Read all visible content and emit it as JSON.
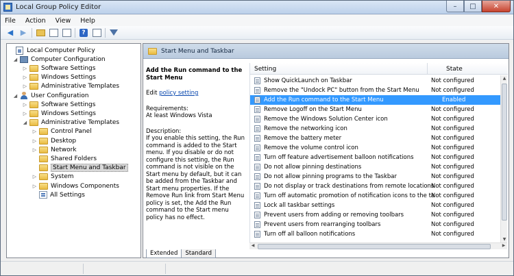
{
  "window": {
    "title": "Local Group Policy Editor",
    "controls": [
      "–",
      "□",
      "✕"
    ]
  },
  "menu": [
    "File",
    "Action",
    "View",
    "Help"
  ],
  "toolbar": {
    "back": "◀",
    "forward": "▶",
    "help": "?"
  },
  "tree": [
    {
      "label": "Local Computer Policy",
      "icon": "policy",
      "expander": "",
      "indent": 0
    },
    {
      "label": "Computer Configuration",
      "icon": "computer",
      "expander": "◢",
      "indent": 1
    },
    {
      "label": "Software Settings",
      "icon": "folder",
      "expander": "▷",
      "indent": 2
    },
    {
      "label": "Windows Settings",
      "icon": "folder",
      "expander": "▷",
      "indent": 2
    },
    {
      "label": "Administrative Templates",
      "icon": "folder",
      "expander": "▷",
      "indent": 2
    },
    {
      "label": "User Configuration",
      "icon": "user",
      "expander": "◢",
      "indent": 1
    },
    {
      "label": "Software Settings",
      "icon": "folder",
      "expander": "▷",
      "indent": 2
    },
    {
      "label": "Windows Settings",
      "icon": "folder",
      "expander": "▷",
      "indent": 2
    },
    {
      "label": "Administrative Templates",
      "icon": "folder",
      "expander": "◢",
      "indent": 2
    },
    {
      "label": "Control Panel",
      "icon": "folder",
      "expander": "▷",
      "indent": 3
    },
    {
      "label": "Desktop",
      "icon": "folder",
      "expander": "▷",
      "indent": 3
    },
    {
      "label": "Network",
      "icon": "folder",
      "expander": "▷",
      "indent": 3
    },
    {
      "label": "Shared Folders",
      "icon": "folder",
      "expander": "",
      "indent": 3
    },
    {
      "label": "Start Menu and Taskbar",
      "icon": "folder",
      "expander": "",
      "indent": 3,
      "selected": true
    },
    {
      "label": "System",
      "icon": "folder",
      "expander": "▷",
      "indent": 3
    },
    {
      "label": "Windows Components",
      "icon": "folder",
      "expander": "▷",
      "indent": 3
    },
    {
      "label": "All Settings",
      "icon": "allsettings",
      "expander": "",
      "indent": 3
    }
  ],
  "pane": {
    "header_title": "Start Menu and Taskbar",
    "desc_title": "Add the Run command to the Start Menu",
    "edit_prefix": "Edit ",
    "edit_link": "policy setting",
    "requirements_label": "Requirements:",
    "requirements_value": "At least Windows Vista",
    "description_label": "Description:",
    "description_text": "If you enable this setting, the Run command is added to the Start menu.  If you disable or do not configure this setting, the Run command is not visible on the Start menu by default, but it can be added from the Taskbar and Start menu properties. If the Remove Run link from Start Menu policy is set, the Add the Run command to the Start menu policy has no effect."
  },
  "list": {
    "col_setting": "Setting",
    "col_state": "State",
    "rows": [
      {
        "setting": "Show QuickLaunch on Taskbar",
        "state": "Not configured"
      },
      {
        "setting": "Remove the \"Undock PC\" button from the Start Menu",
        "state": "Not configured"
      },
      {
        "setting": "Add the Run command to the Start Menu",
        "state": "Enabled",
        "selected": true
      },
      {
        "setting": "Remove Logoff on the Start Menu",
        "state": "Not configured"
      },
      {
        "setting": "Remove the Windows Solution Center icon",
        "state": "Not configured"
      },
      {
        "setting": "Remove the networking icon",
        "state": "Not configured"
      },
      {
        "setting": "Remove the battery meter",
        "state": "Not configured"
      },
      {
        "setting": "Remove the volume control icon",
        "state": "Not configured"
      },
      {
        "setting": "Turn off feature advertisement balloon notifications",
        "state": "Not configured"
      },
      {
        "setting": "Do not allow pinning destinations",
        "state": "Not configured"
      },
      {
        "setting": "Do not allow pinning programs to the Taskbar",
        "state": "Not configured"
      },
      {
        "setting": "Do not display or track destinations from remote locations",
        "state": "Not configured"
      },
      {
        "setting": "Turn off automatic promotion of notification icons to the ta...",
        "state": "Not configured"
      },
      {
        "setting": "Lock all taskbar settings",
        "state": "Not configured"
      },
      {
        "setting": "Prevent users from adding or removing toolbars",
        "state": "Not configured"
      },
      {
        "setting": "Prevent users from rearranging toolbars",
        "state": "Not configured"
      },
      {
        "setting": "Turn off all balloon notifications",
        "state": "Not configured"
      }
    ]
  },
  "tabs": [
    {
      "label": "Extended",
      "active": true
    },
    {
      "label": "Standard",
      "active": false
    }
  ]
}
